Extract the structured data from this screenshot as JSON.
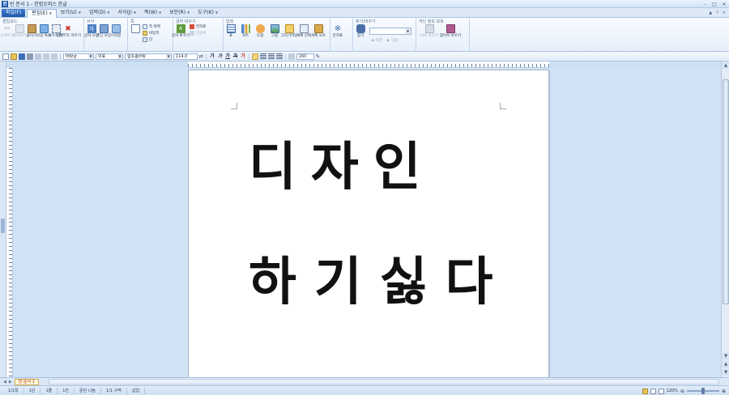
{
  "window": {
    "title": "빈 문서 1 - 한컴오피스 한글",
    "controls": [
      "–",
      "□",
      "×"
    ]
  },
  "menubar": {
    "file": "파일(F)",
    "items": [
      {
        "label": "편집(E)",
        "active": true
      },
      {
        "label": "보기(U)"
      },
      {
        "label": "입력(D)"
      },
      {
        "label": "서식(J)"
      },
      {
        "label": "쪽(W)"
      },
      {
        "label": "보안(R)"
      },
      {
        "label": "도구(K)"
      }
    ],
    "right": [
      "▲",
      "?",
      "×"
    ]
  },
  "ribbon": {
    "groups": {
      "clipboard": {
        "title": "클립보드",
        "tools": [
          "오려두기",
          "복사하기",
          "붙이기",
          "모양 복사",
          "모두 선택",
          "조판 부호 지우기"
        ]
      },
      "format": {
        "title": "서식",
        "tools": [
          "글자 모양",
          "문단 모양",
          "스타일"
        ]
      },
      "page": {
        "title": "쪽",
        "items": [
          "쪽 여백",
          "바탕쪽",
          "단"
        ]
      },
      "char": {
        "title": "글자 바꾸기",
        "tools": [
          "글자 바꾸기"
        ],
        "items": [
          "한자로",
          "한글로"
        ]
      },
      "input": {
        "title": "입력",
        "tools": [
          "표",
          "차트",
          "도형",
          "그림",
          "그리기마당",
          "개체 선택",
          "개체 보호"
        ]
      },
      "symbol": {
        "title": "",
        "tools": [
          "문자표"
        ]
      },
      "find": {
        "title": "찾기/바꾸기",
        "tools": [
          "찾기"
        ],
        "items": [
          "이전",
          "다음"
        ]
      },
      "privacy": {
        "title": "개인 정보 보호",
        "tools": [
          "바로 바꾸기",
          "찾아서 바꾸기"
        ]
      }
    }
  },
  "toolbar": {
    "style": "바탕글",
    "lang": "대표",
    "font": "함초롬바탕",
    "size": "114.0",
    "unit": "pt",
    "bold": "가",
    "italic": "가",
    "underline": "가",
    "strike": "가",
    "color": "가",
    "line_spacing": "160",
    "percent": "%"
  },
  "document": {
    "line1": "디자인",
    "line2": "하기싫다"
  },
  "tabs": {
    "doc_tab": "빈 문서 1"
  },
  "status": {
    "items": [
      "1/1쪽",
      "1단",
      "1줄",
      "1칸",
      "문단 나눔",
      "1/1 구역",
      "삽입"
    ],
    "zoom": "120%"
  }
}
